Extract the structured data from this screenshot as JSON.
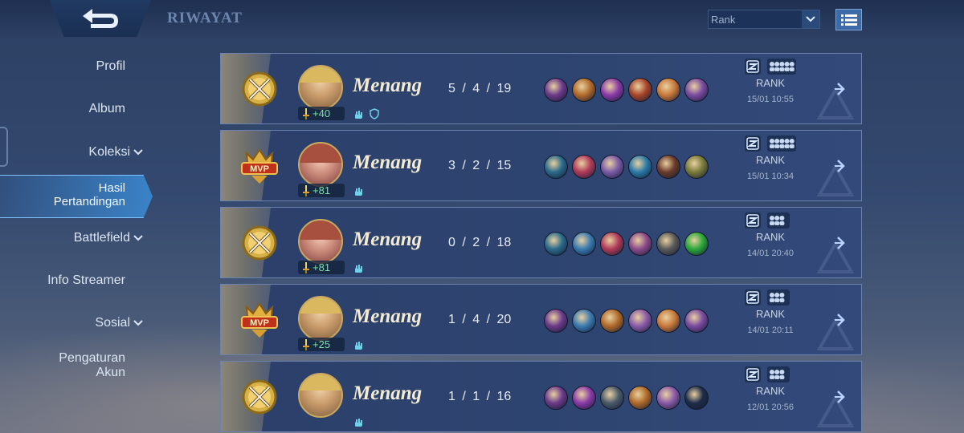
{
  "header": {
    "title": "RIWAYAT",
    "filter": {
      "selected": "Rank"
    }
  },
  "sidebar": {
    "items": [
      {
        "label": "Profil"
      },
      {
        "label": "Album"
      },
      {
        "label": "Koleksi"
      },
      {
        "label": "Hasil\nPertandingan"
      },
      {
        "label": "Battlefield"
      },
      {
        "label": "Info Streamer"
      },
      {
        "label": "Sosial"
      },
      {
        "label": "Pengaturan\nAkun"
      }
    ]
  },
  "matches": [
    {
      "medal": "gold-medal-icon",
      "hero": "male",
      "points": "+40",
      "result": "Menang",
      "kda": "5 / 4 / 19",
      "mode": "RANK",
      "date": "15/01 10:55",
      "items": [
        "#6a3a8a",
        "#b06a2a",
        "#8a3aa8",
        "#a8442a",
        "#c8783a",
        "#7a4aa0"
      ],
      "shield": true,
      "squad": "5"
    },
    {
      "medal": "mvp-medal-icon",
      "hero": "female",
      "points": "+81",
      "result": "Menang",
      "kda": "3 / 2 / 15",
      "mode": "RANK",
      "date": "15/01 10:34",
      "items": [
        "#2a6a8a",
        "#b03a5a",
        "#7a5aa8",
        "#2a7aa8",
        "#6a3a2a",
        "#7a7a3a"
      ],
      "shield": false,
      "squad": "5"
    },
    {
      "medal": "gold-medal-icon",
      "hero": "female",
      "points": "+81",
      "result": "Menang",
      "kda": "0 / 2 / 18",
      "mode": "RANK",
      "date": "14/01 20:40",
      "items": [
        "#2a6a8a",
        "#3a7ab0",
        "#b03a5a",
        "#8a4a8a",
        "#5a5a5a",
        "#2aa83a"
      ],
      "shield": false,
      "squad": "3"
    },
    {
      "medal": "mvp-medal-icon",
      "hero": "male",
      "points": "+25",
      "result": "Menang",
      "kda": "1 / 4 / 20",
      "mode": "RANK",
      "date": "14/01 20:11",
      "items": [
        "#6a3a8a",
        "#3a7ab0",
        "#b06a2a",
        "#8a5aa8",
        "#c8783a",
        "#7a4aa0"
      ],
      "shield": false,
      "squad": "3"
    },
    {
      "medal": "gold-medal-icon",
      "hero": "male",
      "points": "",
      "result": "Menang",
      "kda": "1 / 1 / 16",
      "mode": "RANK",
      "date": "12/01 20:56",
      "items": [
        "#6a3a8a",
        "#8a3aa8",
        "#4a5a6a",
        "#b06a2a",
        "#8a5aa8",
        "#1e2c4a"
      ],
      "shield": false,
      "squad": "3"
    }
  ],
  "colors": {
    "accent": "#4aa8ff",
    "gold": "#d8b048",
    "win_text": "#f3ecd2"
  }
}
